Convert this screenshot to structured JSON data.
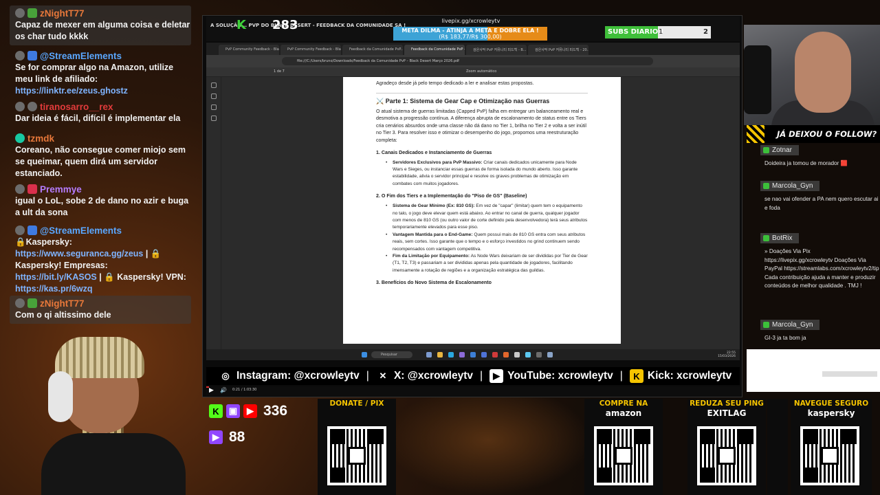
{
  "left_chat": [
    {
      "user": "zNightT77",
      "color": "#e8783a",
      "badges": [
        "avatar",
        "g"
      ],
      "text": "Capaz de mexer em alguma coisa e deletar os char tudo kkkk",
      "highlight": true
    },
    {
      "user": "@StreamElements",
      "color": "#5aa7ff",
      "badges": [
        "wrench",
        "shield"
      ],
      "text": "Se for comprar algo na Amazon, utilize meu link de afiliado:",
      "link": "https://linktr.ee/zeus.ghostz",
      "highlight": false
    },
    {
      "user": "tiranosarro__rex",
      "color": "#e23b3b",
      "badges": [
        "avatar",
        "mute"
      ],
      "text": "Dar ideia é fácil, difícil é implementar ela",
      "highlight": false
    },
    {
      "user": "tzmdk",
      "color": "#e8783a",
      "badges": [
        "teal"
      ],
      "text": "Coreano, não consegue comer miojo sem se queimar, quem dirá um servidor estanciado.",
      "highlight": false
    },
    {
      "user": "Premmye",
      "color": "#b57cff",
      "badges": [
        "avatar",
        "heart"
      ],
      "text": "igual o LoL, sobe 2 de dano no azir e buga a ult da sona",
      "highlight": false
    },
    {
      "user": "@StreamElements",
      "color": "#5aa7ff",
      "badges": [
        "wrench",
        "shield"
      ],
      "text_parts": [
        "🔒Kaspersky: ",
        "https://www.seguranca.gg/zeus",
        " | 🔒 Kaspersky! Empresas: ",
        "https://bit.ly/KASOS",
        " | 🔒 Kaspersky! VPN: ",
        "https://kas.pr/6wzq"
      ],
      "highlight": false
    },
    {
      "user": "zNightT77",
      "color": "#e8783a",
      "badges": [
        "avatar",
        "g"
      ],
      "text": "Com o qi altissimo dele",
      "highlight": true
    }
  ],
  "stream_top": {
    "title": "A SOLUÇÃO... PVP DO BLACK DESERT - FEEDBACK DA COMUNIDADE SA !",
    "k_logo": "K",
    "viewer_count": "283",
    "meta_url": "livepix.gg/xcrowleytv",
    "meta_title": "META DILMA - ATINJA A META E DOBRE ELA !",
    "meta_values": "(R$ 183,77/R$ 300,00)",
    "meta_progress": 0.61,
    "subs_label": "SUBS DIARIO !",
    "subs_current": "1",
    "subs_goal": "2",
    "subs_progress": 0.5
  },
  "browser": {
    "tabs": [
      "PvP Community Feedback - Bla...",
      "PvP Community Feedback - Black D...",
      "Feedback da Comunidade PvP...",
      "Feedback da Comunidade PvP - Bla...",
      "검은사막 PvP 커뮤니티 피드백 - B...",
      "검은사막 PvP 커뮤니티 피드백 - 20..."
    ],
    "active_tab": 3,
    "url": "file:///C:/Users/bruno/Downloads/Feedback da Comunidade PvP – Black Desert Março 2026.pdf",
    "page_current": "1",
    "page_total": "de 7",
    "zoom": "Zoom automático"
  },
  "pdf": {
    "intro": "Agradeço desde já pelo tempo dedicado a ler e analisar estas propostas.",
    "part1_title": "⚔️ Parte 1: Sistema de Gear Cap e Otimização nas Guerras",
    "part1_body": "O atual sistema de guerras limitadas (Capped PvP) falha em entregar um balanceamento real e desmotiva a progressão contínua. A diferença abrupta de escalonamento de status entre os Tiers cria cenários absurdos onde uma classe não dá dano no Tier 1, brilha no Tier 2 e volta a ser inútil no Tier 3. Para resolver isso e otimizar o desempenho do jogo, propomos uma reestruturação completa:",
    "s1_title": "1. Canais Dedicados e Instanciamento de Guerras",
    "s1_items": [
      {
        "b": "Servidores Exclusivos para PvP Massivo:",
        "t": " Criar canais dedicados unicamente para Node Wars e Sieges, ou instanciar essas guerras de forma isolada do mundo aberto. Isso garante estabilidade, alivia o servidor principal e resolve os graves problemas de otimização em combates com muitos jogadores."
      }
    ],
    "s2_title": "2. O Fim dos Tiers e a Implementação do \"Piso de GS\" (Baseline)",
    "s2_items": [
      {
        "b": "Sistema de Gear Mínimo (Ex: 810 GS):",
        "t": " Em vez de \"capar\" (limitar) quem tem o equipamento no talo, o jogo deve elevar quem está abaixo. Ao entrar no canal de guerra, qualquer jogador com menos de 810 GS (ou outro valor de corte definido pela desenvolvedora) terá seus atributos temporariamente elevados para esse piso."
      },
      {
        "b": "Vantagem Mantida para o End-Game:",
        "t": " Quem possui mais de 810 GS entra com seus atributos reais, sem cortes. Isso garante que o tempo e o esforço investidos no grind continuem sendo recompensados com vantagem competitiva."
      },
      {
        "b": "Fim da Limitação por Equipamento:",
        "t": " As Node Wars deixariam de ser divididas por Tier de Gear (T1, T2, T3) e passariam a ser divididas apenas pela quantidade de jogadores, facilitando imensamente a rotação de regiões e a organização estratégica das guildas."
      }
    ],
    "s3_title": "3. Benefícios do Novo Sistema de Escalonamento"
  },
  "taskbar": {
    "search": "Pesquisar",
    "time": "22:55",
    "date": "15/03/2026",
    "lang": "POR PTB2"
  },
  "socials": [
    {
      "icon": "instagram-icon",
      "text": "Instagram: @xcrowleytv"
    },
    {
      "icon": "x-icon",
      "text": "X: @xcrowleytv"
    },
    {
      "icon": "youtube-icon",
      "text": "YouTube: xcrowleytv"
    },
    {
      "icon": "kick-icon",
      "text": "Kick: xcrowleytv"
    }
  ],
  "player": {
    "time": "0:21 / 1:03:30"
  },
  "follow_banner": "JÁ DEIXOU O FOLLOW?",
  "right_chat": [
    {
      "user": "Zotnar",
      "text": "Doideira ja tomou de morador 🟥"
    },
    {
      "user": "Marcola_Gyn",
      "text": "se nao vai ofender a PA nem quero escutar ai e foda"
    },
    {
      "user": "BotRix",
      "text": "» Doações Via Pix https://livepix.gg/xcrowleytv Doações Via PayPal https://streamlabs.com/xcrowleytv2/tip Cada contribuição ajuda a manter e produzir conteúdos de melhor qualidade . TMJ !"
    },
    {
      "user": "Marcola_Gyn",
      "text": "GI-3 ja ta bom ja"
    }
  ],
  "counters": {
    "combined": "336",
    "youtube_live": "88"
  },
  "qr_cards": [
    {
      "label1": "DONATE / PIX",
      "label2": ""
    },
    {
      "label1": "COMPRE NA",
      "label2": "amazon"
    },
    {
      "label1": "REDUZA SEU PING",
      "label2": "EXITLAG"
    },
    {
      "label1": "NAVEGUE SEGURO",
      "label2": "kaspersky"
    }
  ],
  "colors": {
    "kick_green": "#53fc18",
    "twitch_purple": "#9146ff",
    "youtube_red": "#ff0000",
    "accent_yellow": "#f5c400"
  }
}
